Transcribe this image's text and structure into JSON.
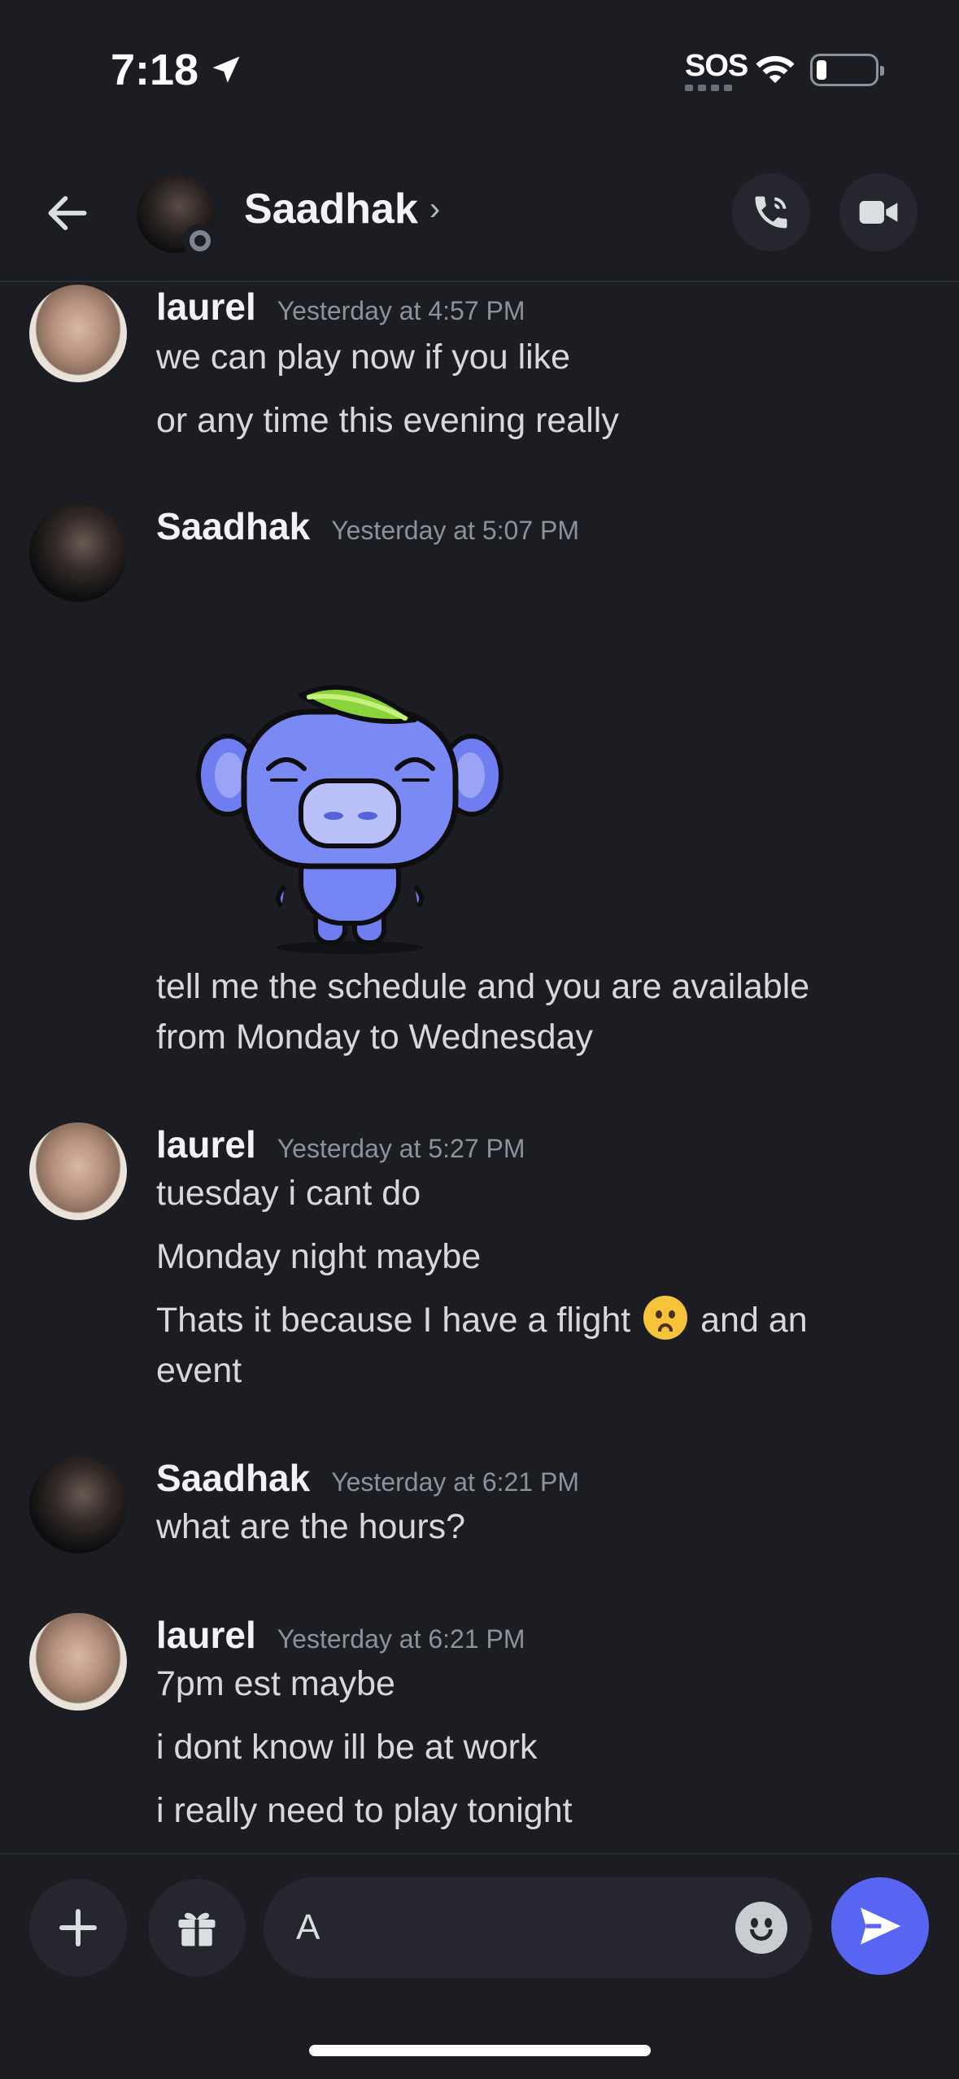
{
  "status_bar": {
    "time": "7:18",
    "carrier": "SOS",
    "icons": [
      "location-arrow-icon",
      "wifi-icon",
      "battery-icon"
    ]
  },
  "header": {
    "name": "Saadhak",
    "chevron": "›",
    "status": "offline",
    "icons": [
      "back-arrow-icon",
      "phone-call-icon",
      "video-camera-icon"
    ]
  },
  "messages": [
    {
      "author": "laurel",
      "timestamp": "Yesterday at 4:57 PM",
      "lines": [
        "we can play now if you like",
        "or any time this evening really"
      ]
    },
    {
      "author": "Saadhak",
      "timestamp": "Yesterday at 5:07 PM",
      "sticker": "wumpus-leaf-sticker",
      "lines": [
        "tell me the schedule and you are available from Monday to Wednesday"
      ]
    },
    {
      "author": "laurel",
      "timestamp": "Yesterday at 5:27 PM",
      "lines": [
        "tuesday i cant do",
        "Monday night maybe",
        "Thats it because I have a flight",
        "and an event"
      ]
    },
    {
      "author": "Saadhak",
      "timestamp": "Yesterday at 6:21 PM",
      "lines": [
        "what are the hours?"
      ]
    },
    {
      "author": "laurel",
      "timestamp": "Yesterday at 6:21 PM",
      "lines": [
        "7pm est maybe",
        "i dont know ill be at work",
        "i really need to play tonight"
      ]
    }
  ],
  "composer": {
    "value": "A",
    "icons": [
      "plus-icon",
      "gift-icon",
      "emoji-icon",
      "send-icon"
    ]
  },
  "colors": {
    "accent": "#5865f2",
    "background": "#1c1d23",
    "surface": "#26272e"
  }
}
